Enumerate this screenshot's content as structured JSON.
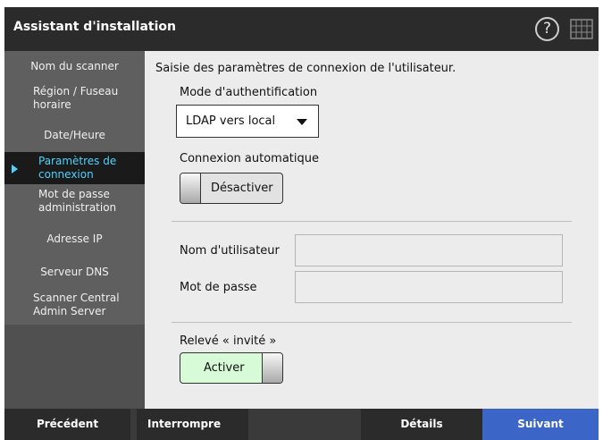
{
  "window": {
    "title": "Assistant d'installation"
  },
  "header": {
    "help_icon": "question-circle-icon",
    "keyboard_icon": "keyboard-icon"
  },
  "sidebar": {
    "items": [
      {
        "label": "Nom du scanner"
      },
      {
        "label": "Région / Fuseau horaire"
      },
      {
        "label": "Date/Heure"
      },
      {
        "label": "Paramètres de connexion",
        "active": true
      },
      {
        "label": "Mot de passe administration"
      },
      {
        "label": "Adresse IP"
      },
      {
        "label": "Serveur DNS"
      },
      {
        "label": "Scanner Central Admin Server"
      }
    ]
  },
  "main": {
    "intro": "Saisie des paramètres de connexion de l'utilisateur.",
    "auth_mode": {
      "label": "Mode d'authentification",
      "value": "LDAP vers local"
    },
    "auto_login": {
      "label": "Connexion automatique",
      "toggle_label": "Désactiver",
      "state": "off"
    },
    "username": {
      "label": "Nom d'utilisateur",
      "value": ""
    },
    "password": {
      "label": "Mot de passe",
      "value": ""
    },
    "guest": {
      "label": "Relevé « invité »",
      "toggle_label": "Activer",
      "state": "on"
    }
  },
  "footer": {
    "previous": "Précédent",
    "abort": "Interrompre",
    "details": "Détails",
    "next": "Suivant"
  },
  "colors": {
    "accent_active": "#4fd2ff",
    "primary_button": "#3c65c8",
    "toggle_on": "#d6fbd6"
  }
}
